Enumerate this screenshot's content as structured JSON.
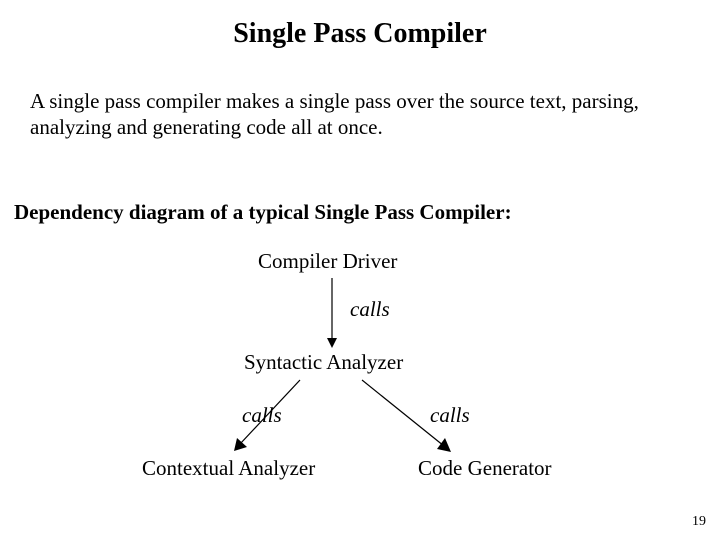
{
  "title": "Single Pass Compiler",
  "intro": "A single pass compiler makes a single pass over the source text, parsing, analyzing and generating code all at once.",
  "subhead": "Dependency diagram of a typical Single Pass Compiler:",
  "diagram": {
    "nodes": {
      "driver": "Compiler Driver",
      "syntactic": "Syntactic Analyzer",
      "contextual": "Contextual Analyzer",
      "codegen": "Code Generator"
    },
    "edge_labels": {
      "driver_syntactic": "calls",
      "syntactic_contextual": "calls",
      "syntactic_codegen": "calls"
    }
  },
  "page_number": "19"
}
